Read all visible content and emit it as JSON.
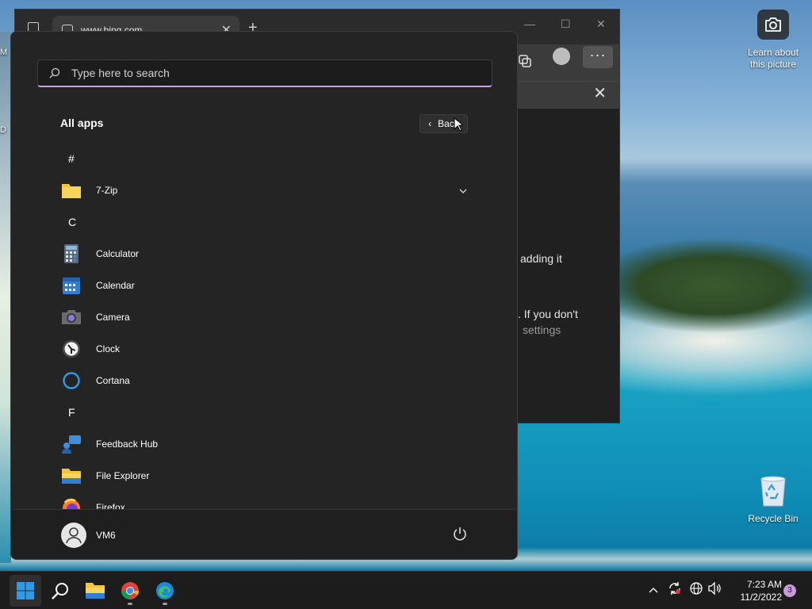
{
  "desktop": {
    "learn_about_line1": "Learn about",
    "learn_about_line2": "this picture",
    "recycle_bin_label": "Recycle Bin",
    "edge_partial_left_1": "M",
    "edge_partial_left_2": "D"
  },
  "edge": {
    "tab_title": "www.bing.com",
    "partial_text_1": "adding it",
    "partial_text_2": ". If you don't",
    "partial_text_3": "settings"
  },
  "start_menu": {
    "search_placeholder": "Type here to search",
    "all_apps_title": "All apps",
    "back_label": "Back",
    "apps": [
      {
        "type": "letter",
        "label": "#"
      },
      {
        "type": "app",
        "label": "7-Zip",
        "icon": "folder-icon",
        "expandable": true
      },
      {
        "type": "letter",
        "label": "C"
      },
      {
        "type": "app",
        "label": "Calculator",
        "icon": "calculator-icon"
      },
      {
        "type": "app",
        "label": "Calendar",
        "icon": "calendar-icon"
      },
      {
        "type": "app",
        "label": "Camera",
        "icon": "camera-icon"
      },
      {
        "type": "app",
        "label": "Clock",
        "icon": "clock-icon"
      },
      {
        "type": "app",
        "label": "Cortana",
        "icon": "cortana-icon"
      },
      {
        "type": "letter",
        "label": "F"
      },
      {
        "type": "app",
        "label": "Feedback Hub",
        "icon": "feedback-hub-icon"
      },
      {
        "type": "app",
        "label": "File Explorer",
        "icon": "file-explorer-icon"
      },
      {
        "type": "app",
        "label": "Firefox",
        "icon": "firefox-icon"
      }
    ],
    "user_name": "VM6"
  },
  "taskbar": {
    "time": "7:23 AM",
    "date": "11/2/2022",
    "notification_count": "3"
  },
  "colors": {
    "accent": "#c8a2e8",
    "menu_bg": "#242424",
    "taskbar_bg": "#1c1c1c"
  }
}
